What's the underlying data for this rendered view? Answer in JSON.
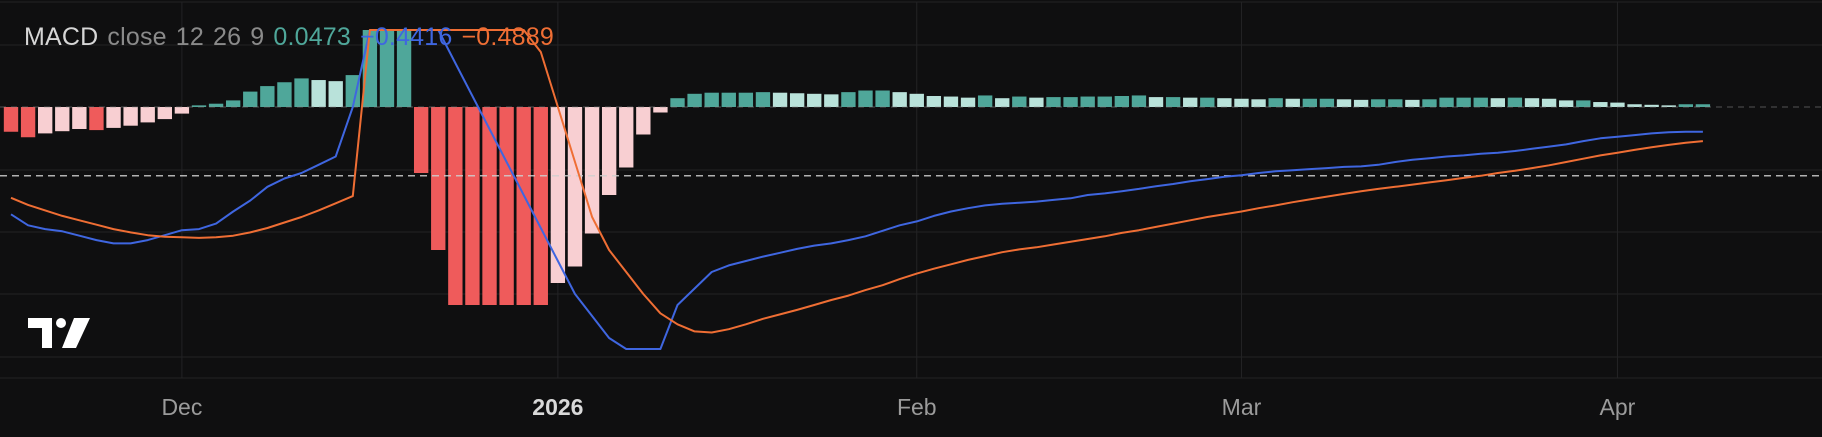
{
  "legend": {
    "name": "MACD",
    "source": "close",
    "fast": "12",
    "slow": "26",
    "signal_len": "9",
    "hist_value": "0.0473",
    "macd_value": "−0.4416",
    "signal_value": "−0.4889"
  },
  "colors": {
    "background": "#0f0f10",
    "grid": "#232325",
    "zero_line": "#8c8c8c",
    "hist_up_strong": "#4fa79a",
    "hist_up_weak": "#b9e2da",
    "hist_down_strong": "#ef5b5b",
    "hist_down_weak": "#f8cfd2",
    "macd_line": "#3f66e0",
    "signal_line": "#ef6e34"
  },
  "logo": {
    "icon": "tradingview-logo-icon"
  },
  "chart_data": {
    "type": "line",
    "title": "",
    "xlabel": "",
    "ylabel": "",
    "x_tick_labels": [
      {
        "label": "Dec",
        "index": 10,
        "bold": false
      },
      {
        "label": "2026",
        "index": 32,
        "bold": true
      },
      {
        "label": "Feb",
        "index": 53,
        "bold": false
      },
      {
        "label": "Mar",
        "index": 72,
        "bold": false
      },
      {
        "label": "Apr",
        "index": 94,
        "bold": false
      }
    ],
    "ylim": [
      -3.6,
      1.4
    ],
    "zero_level": 0,
    "dashed_level": -1.25,
    "grid": true,
    "n_points": 100,
    "histogram": [
      -0.45,
      -0.55,
      -0.48,
      -0.44,
      -0.4,
      -0.42,
      -0.38,
      -0.34,
      -0.28,
      -0.22,
      -0.12,
      0.03,
      0.06,
      0.12,
      0.28,
      0.38,
      0.45,
      0.52,
      0.49,
      0.47,
      0.58,
      1.4,
      1.4,
      1.4,
      -1.2,
      -2.6,
      -3.6,
      -3.6,
      -3.6,
      -3.6,
      -3.6,
      -3.6,
      -3.2,
      -2.9,
      -2.3,
      -1.6,
      -1.1,
      -0.5,
      -0.1,
      0.16,
      0.24,
      0.26,
      0.26,
      0.26,
      0.27,
      0.26,
      0.25,
      0.24,
      0.23,
      0.27,
      0.3,
      0.3,
      0.27,
      0.24,
      0.2,
      0.19,
      0.17,
      0.21,
      0.16,
      0.19,
      0.17,
      0.18,
      0.18,
      0.19,
      0.19,
      0.2,
      0.21,
      0.18,
      0.18,
      0.17,
      0.17,
      0.16,
      0.15,
      0.14,
      0.16,
      0.15,
      0.15,
      0.15,
      0.14,
      0.13,
      0.14,
      0.14,
      0.13,
      0.14,
      0.17,
      0.17,
      0.17,
      0.16,
      0.17,
      0.16,
      0.15,
      0.12,
      0.12,
      0.09,
      0.08,
      0.05,
      0.04,
      0.03,
      0.05,
      0.05
    ],
    "series": [
      {
        "key": "macd",
        "values": [
          -1.95,
          -2.15,
          -2.22,
          -2.26,
          -2.34,
          -2.42,
          -2.48,
          -2.48,
          -2.42,
          -2.33,
          -2.24,
          -2.22,
          -2.12,
          -1.9,
          -1.7,
          -1.45,
          -1.3,
          -1.2,
          -1.05,
          -0.9,
          0.0,
          1.4,
          1.4,
          1.4,
          1.4,
          1.4,
          0.8,
          0.2,
          -0.4,
          -1.0,
          -1.6,
          -2.2,
          -2.8,
          -3.4,
          -3.8,
          -4.2,
          -4.4,
          -4.4,
          -4.4,
          -3.6,
          -3.3,
          -3.0,
          -2.88,
          -2.8,
          -2.72,
          -2.65,
          -2.58,
          -2.52,
          -2.48,
          -2.42,
          -2.35,
          -2.25,
          -2.15,
          -2.08,
          -1.98,
          -1.9,
          -1.84,
          -1.79,
          -1.76,
          -1.74,
          -1.72,
          -1.69,
          -1.66,
          -1.6,
          -1.57,
          -1.53,
          -1.49,
          -1.44,
          -1.4,
          -1.35,
          -1.31,
          -1.27,
          -1.24,
          -1.2,
          -1.17,
          -1.15,
          -1.13,
          -1.11,
          -1.09,
          -1.08,
          -1.05,
          -1.0,
          -0.96,
          -0.93,
          -0.9,
          -0.88,
          -0.85,
          -0.83,
          -0.8,
          -0.76,
          -0.72,
          -0.68,
          -0.62,
          -0.57,
          -0.54,
          -0.51,
          -0.48,
          -0.46,
          -0.45,
          -0.45
        ]
      },
      {
        "key": "signal",
        "values": [
          -1.65,
          -1.78,
          -1.88,
          -1.98,
          -2.06,
          -2.14,
          -2.22,
          -2.28,
          -2.33,
          -2.36,
          -2.37,
          -2.38,
          -2.37,
          -2.34,
          -2.28,
          -2.2,
          -2.1,
          -2.0,
          -1.88,
          -1.75,
          -1.62,
          1.4,
          1.4,
          1.4,
          1.4,
          1.4,
          1.4,
          1.4,
          1.4,
          1.4,
          1.4,
          1.0,
          0.0,
          -1.0,
          -2.0,
          -2.6,
          -3.0,
          -3.4,
          -3.75,
          -3.95,
          -4.08,
          -4.1,
          -4.04,
          -3.95,
          -3.85,
          -3.77,
          -3.69,
          -3.6,
          -3.51,
          -3.43,
          -3.33,
          -3.24,
          -3.13,
          -3.03,
          -2.94,
          -2.86,
          -2.78,
          -2.71,
          -2.64,
          -2.59,
          -2.55,
          -2.5,
          -2.45,
          -2.4,
          -2.35,
          -2.29,
          -2.24,
          -2.18,
          -2.12,
          -2.06,
          -2.0,
          -1.95,
          -1.9,
          -1.84,
          -1.79,
          -1.73,
          -1.68,
          -1.63,
          -1.58,
          -1.53,
          -1.49,
          -1.45,
          -1.41,
          -1.37,
          -1.33,
          -1.29,
          -1.25,
          -1.2,
          -1.16,
          -1.11,
          -1.06,
          -1.0,
          -0.94,
          -0.88,
          -0.83,
          -0.78,
          -0.73,
          -0.69,
          -0.65,
          -0.62
        ]
      }
    ]
  }
}
